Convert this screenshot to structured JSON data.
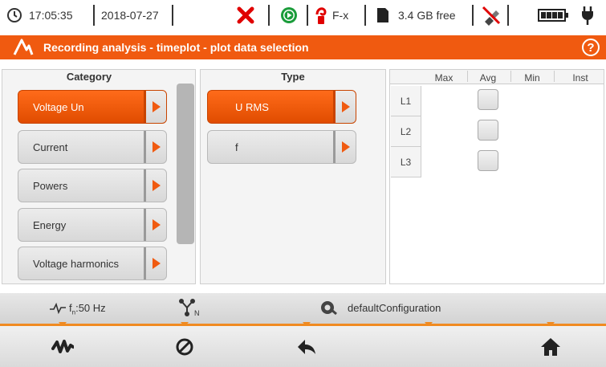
{
  "status": {
    "time": "17:05:35",
    "date": "2018-07-27",
    "clamp_label": "F-x",
    "storage": "3.4 GB free"
  },
  "title": "Recording analysis - timeplot - plot data selection",
  "category": {
    "header": "Category",
    "items": [
      {
        "label": "Voltage Un",
        "active": true
      },
      {
        "label": "Current",
        "active": false
      },
      {
        "label": "Powers",
        "active": false
      },
      {
        "label": "Energy",
        "active": false
      },
      {
        "label": "Voltage harmonics",
        "active": false
      }
    ]
  },
  "type": {
    "header": "Type",
    "items": [
      {
        "label": "U RMS",
        "active": true
      },
      {
        "label": "f",
        "active": false
      }
    ]
  },
  "table": {
    "columns": [
      "Max",
      "Avg",
      "Min",
      "Inst"
    ],
    "rows": [
      "L1",
      "L2",
      "L3"
    ]
  },
  "infobar": {
    "frequency_prefix": "f",
    "frequency_sub": "n",
    "frequency_value": ":50 Hz",
    "configuration": "defaultConfiguration"
  },
  "colors": {
    "accent": "#f05a10",
    "cancel": "#e00000",
    "play": "#1a9c3a"
  }
}
